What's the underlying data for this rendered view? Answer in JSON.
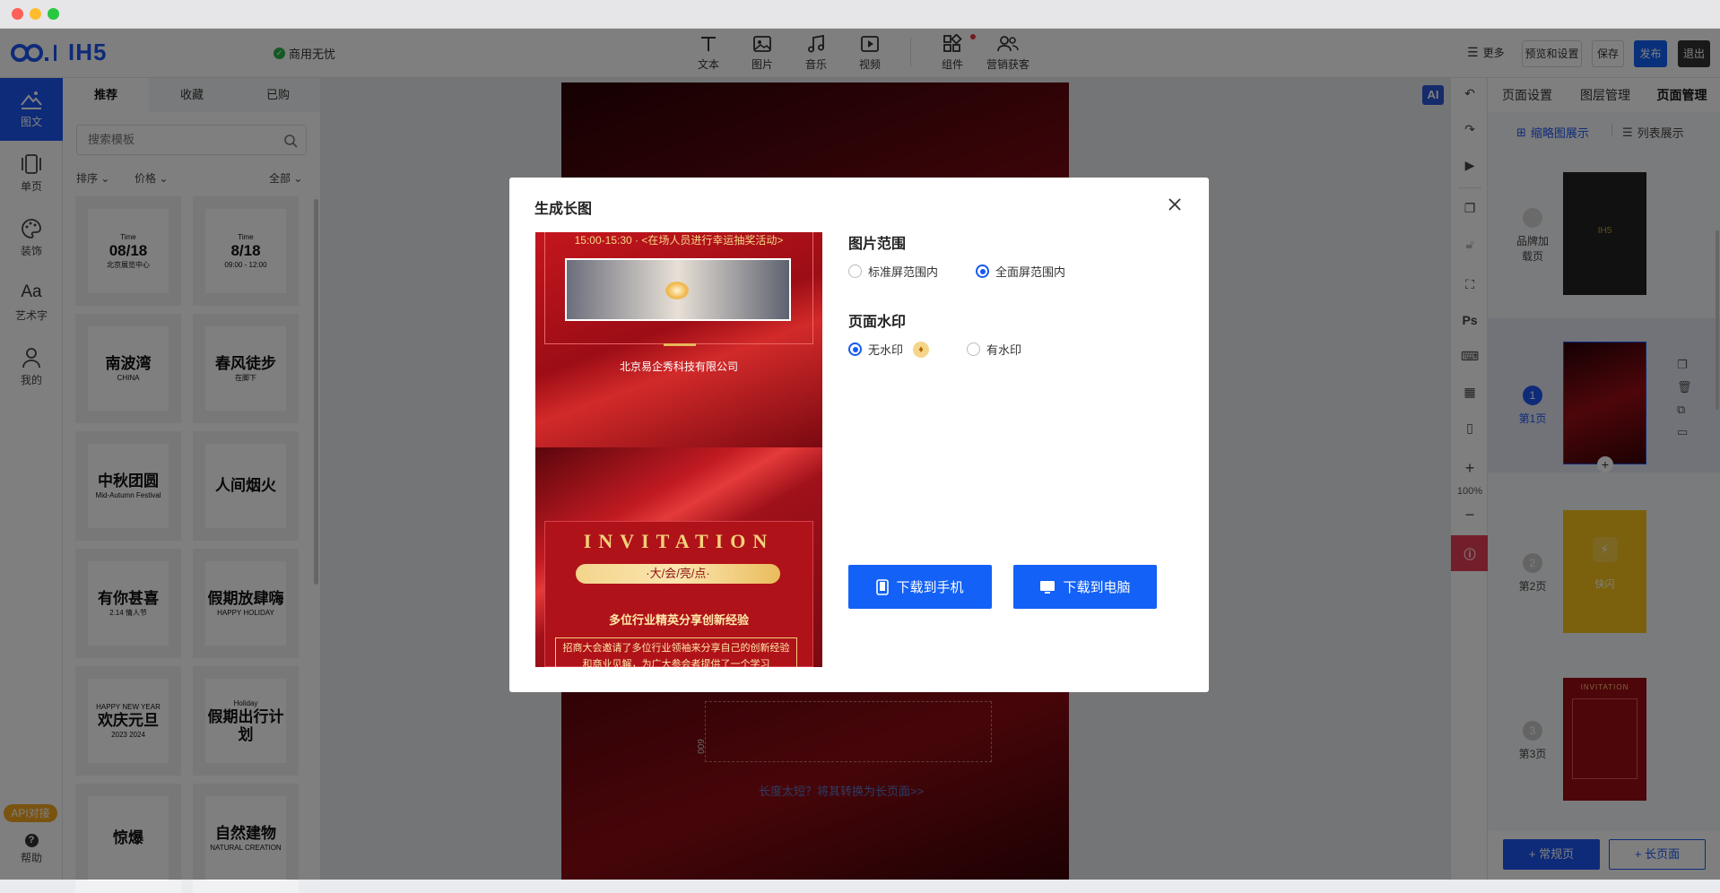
{
  "header": {
    "logo": "IH5",
    "license": "商用无忧",
    "tools": [
      "文本",
      "图片",
      "音乐",
      "视频",
      "组件",
      "营销获客"
    ],
    "more": "更多",
    "preview": "预览和设置",
    "save": "保存",
    "publish": "发布",
    "exit": "退出"
  },
  "rail": {
    "items": [
      "图文",
      "单页",
      "装饰",
      "艺术字",
      "我的"
    ],
    "api": "API对接",
    "help": "帮助"
  },
  "templates": {
    "tabs": [
      "推荐",
      "收藏",
      "已购"
    ],
    "search_placeholder": "搜索模板",
    "sort": "排序",
    "price": "价格",
    "all": "全部",
    "items": [
      {
        "a": "Time",
        "b": "08/18",
        "c": "北京展览中心"
      },
      {
        "a": "Time",
        "b": "8/18",
        "c": "09:00 - 12:00"
      },
      {
        "a": "",
        "b": "南波湾",
        "c": "CHINA"
      },
      {
        "a": "",
        "b": "春风徒步",
        "c": "在脚下"
      },
      {
        "a": "",
        "b": "中秋团圆",
        "c": "Mid-Autumn Festival"
      },
      {
        "a": "",
        "b": "人间烟火",
        "c": ""
      },
      {
        "a": "",
        "b": "有你甚喜",
        "c": "2.14 情人节"
      },
      {
        "a": "",
        "b": "假期放肆嗨",
        "c": "HAPPY HOLIDAY"
      },
      {
        "a": "HAPPY NEW YEAR",
        "b": "欢庆元旦",
        "c": "2023 2024"
      },
      {
        "a": "Holiday",
        "b": "假期出行计划",
        "c": ""
      },
      {
        "a": "",
        "b": "惊爆",
        "c": ""
      },
      {
        "a": "",
        "b": "自然建物",
        "c": "NATURAL CREATION"
      }
    ]
  },
  "canvas": {
    "height_label": "600",
    "long_hint": "长度太短？将其转换为长页面>>"
  },
  "right_toolbar": {
    "zoom": "100%",
    "ps": "Ps",
    "ai": "AI"
  },
  "right_panel": {
    "tabs": [
      "页面设置",
      "图层管理",
      "页面管理"
    ],
    "view_thumb": "缩略图展示",
    "view_list": "列表展示",
    "pages": [
      {
        "num": "",
        "label": "品牌加载页",
        "thumb_text": "IH5"
      },
      {
        "num": "1",
        "label": "第1页",
        "thumb_text": ""
      },
      {
        "num": "2",
        "label": "第2页",
        "thumb_text": "快闪"
      },
      {
        "num": "3",
        "label": "第3页",
        "thumb_text": "INVITATION"
      }
    ],
    "add_normal": "+ 常规页",
    "add_long": "+ 长页面"
  },
  "modal": {
    "title": "生成长图",
    "range_title": "图片范围",
    "range_options": [
      "标准屏范围内",
      "全面屏范围内"
    ],
    "range_selected": 1,
    "watermark_title": "页面水印",
    "watermark_options": [
      "无水印",
      "有水印"
    ],
    "watermark_selected": 0,
    "download_phone": "下载到手机",
    "download_pc": "下载到电脑",
    "preview": {
      "time_line": "15:00-15:30  ·  <在场人员进行幸运抽奖活动>",
      "company": "北京易企秀科技有限公司",
      "invitation": "INVITATION",
      "highlight": "·大/会/亮/点·",
      "headline": "多位行业精英分享创新经验",
      "body": "招商大会邀请了多位行业领袖来分享自己的创新经验和商业见解，为广大参会者提供了一个学习"
    }
  },
  "colors": {
    "accent": "#1361f6",
    "rail_active": "#1d56f2",
    "red": "#b3141b",
    "gold": "#f2d27a"
  }
}
